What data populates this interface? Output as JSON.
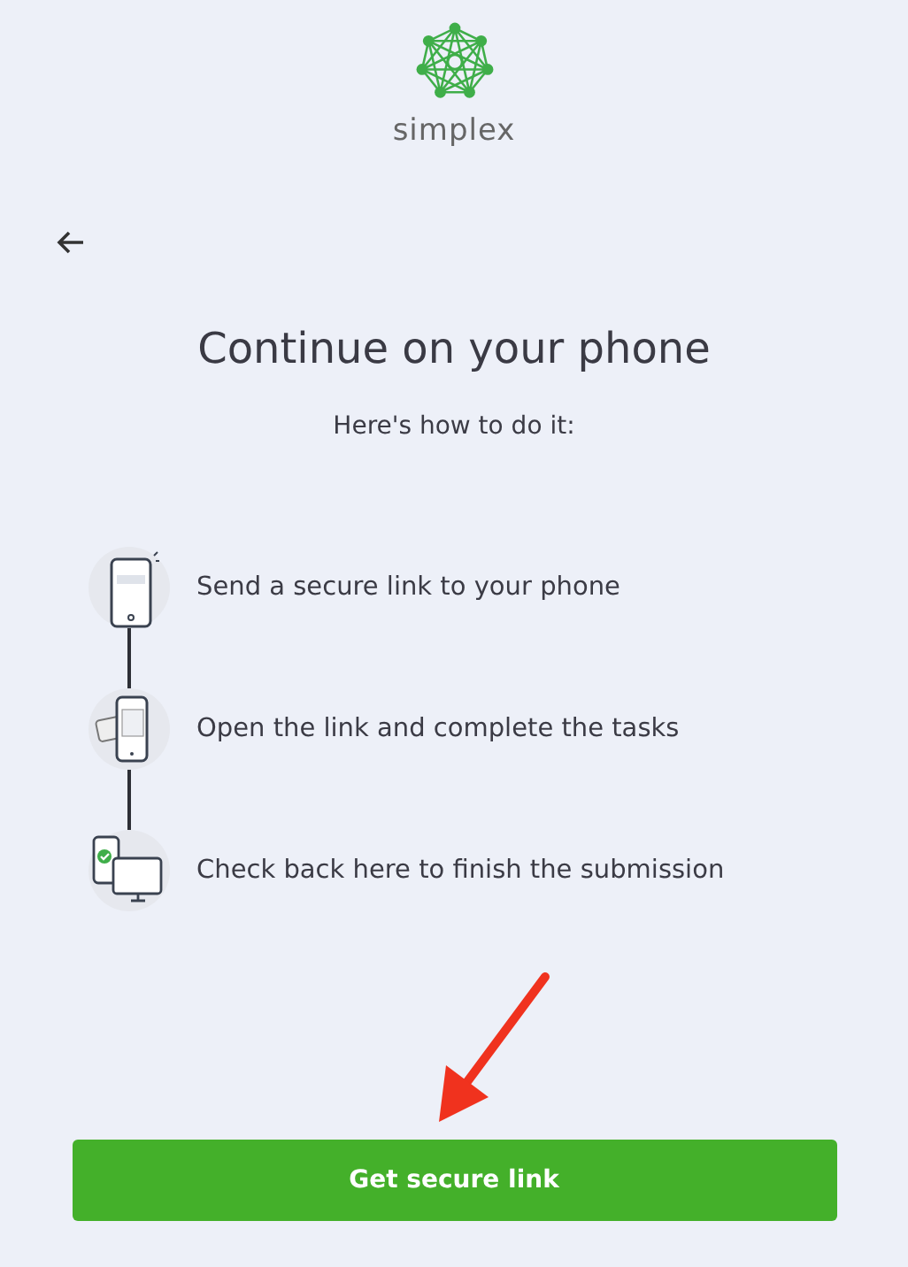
{
  "logo": {
    "text": "simplex"
  },
  "title": "Continue on your phone",
  "subtitle": "Here's how to do it:",
  "steps": [
    {
      "kind": "phone",
      "text": "Send a secure link to your phone"
    },
    {
      "kind": "tasks",
      "text": "Open the link and complete the tasks"
    },
    {
      "kind": "devices",
      "text": "Check back here to finish the submission"
    }
  ],
  "button": "Get secure link"
}
